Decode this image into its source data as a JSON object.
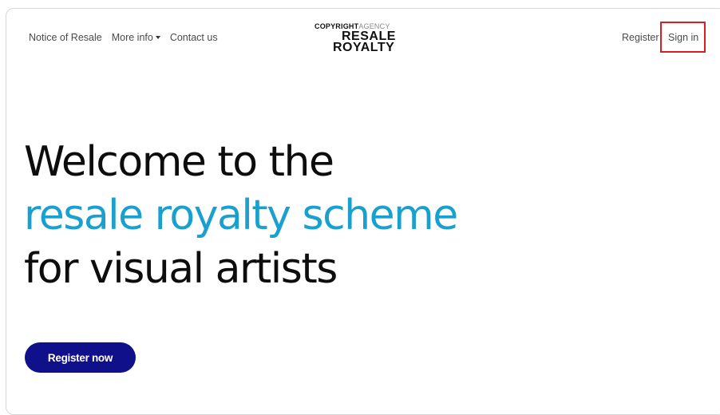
{
  "nav": {
    "left_links": [
      {
        "label": "Notice of Resale"
      },
      {
        "label": "More info",
        "has_dropdown": true
      },
      {
        "label": "Contact us"
      }
    ],
    "logo": {
      "top_bold": "COPYRIGHT",
      "top_light": "AGENCY",
      "line1": "RESALE",
      "line2": "ROYALTY"
    },
    "register_label": "Register",
    "signin_label": "Sign in",
    "highlight_color": "#d81e1e"
  },
  "hero": {
    "line1": "Welcome to the",
    "line2": "resale royalty scheme",
    "line3": "for visual artists",
    "accent_color": "#1aa0cf"
  },
  "cta": {
    "label": "Register now",
    "color": "#10108a"
  }
}
